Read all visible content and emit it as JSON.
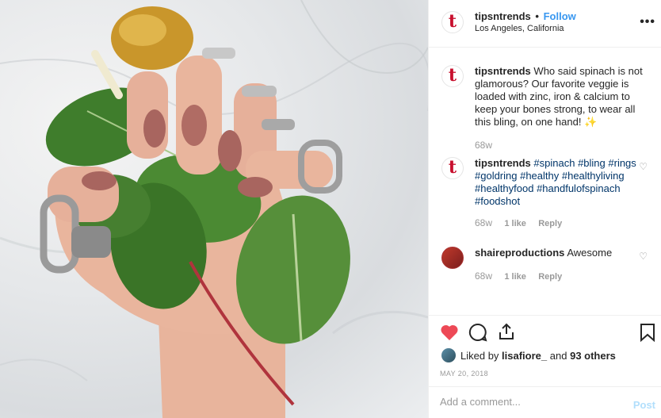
{
  "post": {
    "username": "tipsntrends",
    "follow_label": "Follow",
    "location": "Los Angeles, California",
    "more_label": "•••"
  },
  "comments": [
    {
      "username": "tipsntrends",
      "text": "Who said spinach is not glamorous? Our favorite veggie is loaded with zinc, iron & calcium to keep your bones strong, to wear all this bling, on one hand! ✨",
      "time": "68w"
    },
    {
      "username": "tipsntrends",
      "hashtags": "#spinach #bling #rings #goldring #healthy #healthyliving #healthyfood #handfulofspinach #foodshot",
      "time": "68w",
      "likes": "1 like",
      "reply": "Reply"
    },
    {
      "username": "shaireproductions",
      "text": "Awesome",
      "time": "68w",
      "likes": "1 like",
      "reply": "Reply"
    }
  ],
  "likes": {
    "prefix": "Liked by",
    "user": "lisafiore_",
    "middle": "and",
    "others": "93 others"
  },
  "date": "MAY 20, 2018",
  "add_comment": {
    "placeholder": "Add a comment...",
    "post_label": "Post"
  },
  "colors": {
    "brand": "#c8102e",
    "link": "#3897f0",
    "hashtag": "#003569",
    "liked": "#ed4956"
  },
  "icons": [
    "heart-icon",
    "comment-icon",
    "share-icon",
    "bookmark-icon",
    "more-icon"
  ]
}
